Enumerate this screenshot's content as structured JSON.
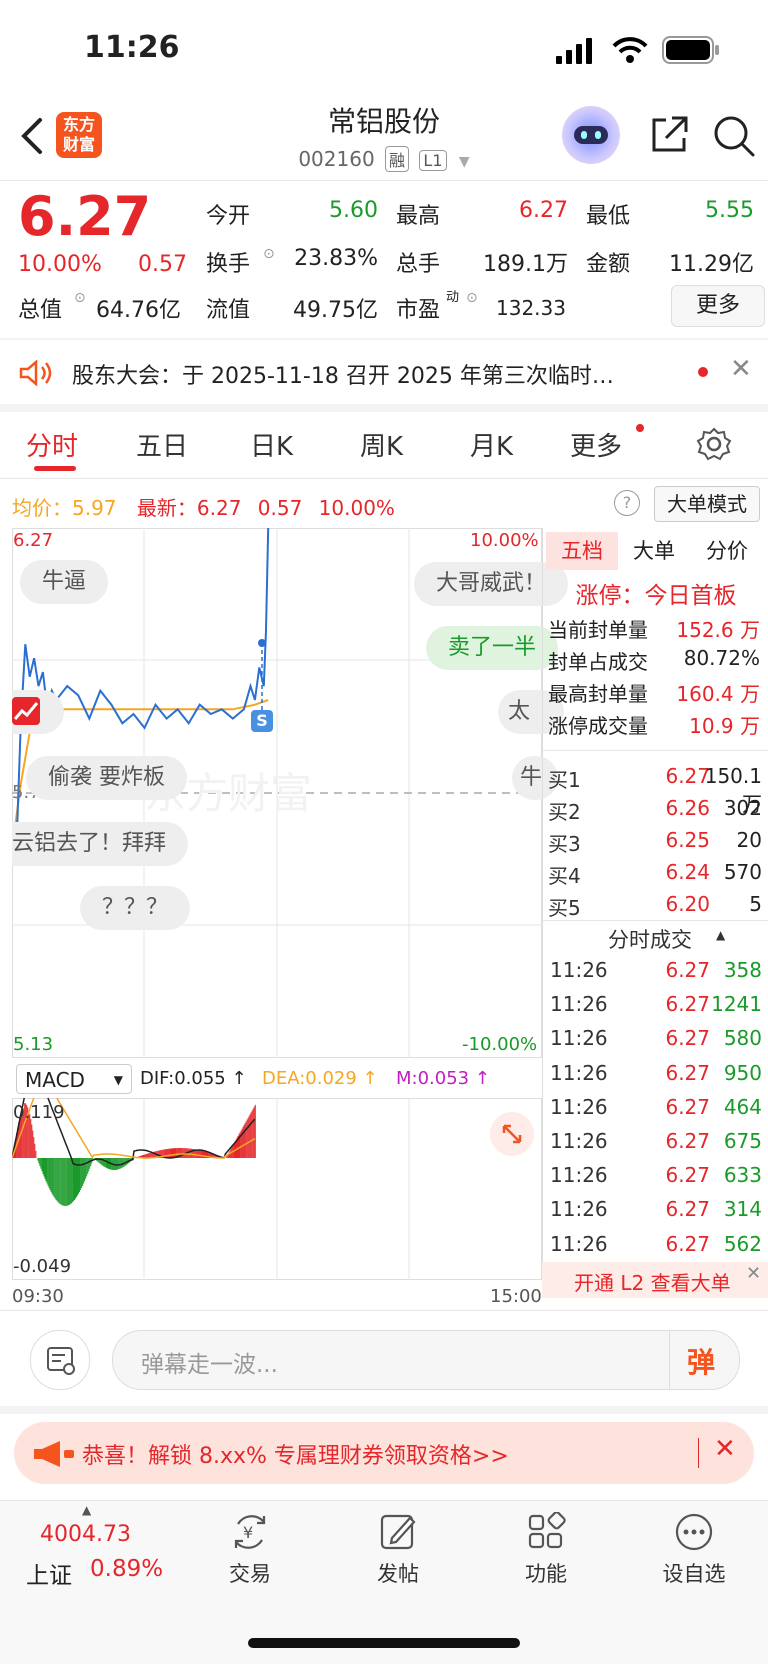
{
  "status_bar": {
    "time": "11:26"
  },
  "header": {
    "title": "常铝股份",
    "code": "002160",
    "tag1": "融",
    "tag2": "L1",
    "logo_text": "东方\n财富"
  },
  "quote": {
    "price": "6.27",
    "change_pct": "10.00%",
    "change_amt": "0.57",
    "open_label": "今开",
    "open": "5.60",
    "high_label": "最高",
    "high": "6.27",
    "low_label": "最低",
    "low": "5.55",
    "turnover_label": "换手",
    "turnover": "23.83%",
    "volume_label": "总手",
    "volume": "189.1万",
    "amount_label": "金额",
    "amount": "11.29亿",
    "mktcap_label": "总值",
    "mktcap": "64.76亿",
    "float_label": "流值",
    "float": "49.75亿",
    "pe_label": "市盈",
    "pe_sup": "动",
    "pe": "132.33",
    "more_label": "更多"
  },
  "notice": {
    "text": "股东大会：于 2025-11-18 召开 2025 年第三次临时…"
  },
  "tabs": [
    "分时",
    "五日",
    "日K",
    "周K",
    "月K",
    "更多"
  ],
  "chart_info": {
    "avg_label": "均价：",
    "avg": "5.97",
    "latest_label": "最新：",
    "latest": "6.27",
    "latest_chg": "0.57",
    "latest_pct": "10.00%",
    "mode_button": "大单模式"
  },
  "chart_labels": {
    "y_top": "6.27",
    "y_mid": "5.70",
    "y_bottom": "5.13",
    "pct_top": "10.00%",
    "pct_bottom": "-10.00%",
    "signal_marker": "S",
    "macd_select": "MACD",
    "dif": "DIF:0.055 ↑",
    "dea": "DEA:0.029 ↑",
    "m": "M:0.053 ↑",
    "macd_top": "0.119",
    "macd_bottom": "-0.049",
    "time_start": "09:30",
    "time_end": "15:00",
    "watermark": "东方财富"
  },
  "danmu": [
    "牛逼",
    "大哥威武！",
    "卖了一半",
    "太",
    "偷袭 要炸板",
    "牛",
    "云铝去了！拜拜",
    "？？？"
  ],
  "right_panel": {
    "tabs": [
      "五档",
      "大单",
      "分价"
    ],
    "limit_status": "涨停：今日首板",
    "stats": [
      {
        "label": "当前封单量",
        "value": "152.6 万"
      },
      {
        "label": "封单占成交",
        "value": "80.72%"
      },
      {
        "label": "最高封单量",
        "value": "160.4 万"
      },
      {
        "label": "涨停成交量",
        "value": "10.9 万"
      }
    ],
    "bids": [
      {
        "label": "买1",
        "price": "6.27",
        "vol": "150.1万"
      },
      {
        "label": "买2",
        "price": "6.26",
        "vol": "302"
      },
      {
        "label": "买3",
        "price": "6.25",
        "vol": "20"
      },
      {
        "label": "买4",
        "price": "6.24",
        "vol": "570"
      },
      {
        "label": "买5",
        "price": "6.20",
        "vol": "5"
      }
    ],
    "trades_header": "分时成交",
    "trades": [
      {
        "time": "11:26",
        "price": "6.27",
        "vol": "358"
      },
      {
        "time": "11:26",
        "price": "6.27",
        "vol": "1241"
      },
      {
        "time": "11:26",
        "price": "6.27",
        "vol": "580"
      },
      {
        "time": "11:26",
        "price": "6.27",
        "vol": "950"
      },
      {
        "time": "11:26",
        "price": "6.27",
        "vol": "464"
      },
      {
        "time": "11:26",
        "price": "6.27",
        "vol": "675"
      },
      {
        "time": "11:26",
        "price": "6.27",
        "vol": "633"
      },
      {
        "time": "11:26",
        "price": "6.27",
        "vol": "314"
      },
      {
        "time": "11:26",
        "price": "6.27",
        "vol": "562"
      }
    ],
    "l2_banner": "开通 L2 查看大单"
  },
  "danmu_input": {
    "placeholder": "弹幕走一波...",
    "send_label": "弹"
  },
  "promo": {
    "text": "恭喜！解锁 8.xx% 专属理财券领取资格>>"
  },
  "bottom_bar": {
    "index_value": "4004.73",
    "index_name": "上证",
    "index_pct": "0.89%",
    "items": [
      "交易",
      "发帖",
      "功能",
      "设自选"
    ]
  },
  "colors": {
    "up": "#e5262a",
    "down": "#1a9a2a",
    "avg_line": "#f5a623",
    "price_line": "#2a6fd1",
    "accent": "#f5541f"
  },
  "chart_data": {
    "type": "line",
    "title": "",
    "x_range": [
      "09:30",
      "15:00"
    ],
    "ylim": [
      5.13,
      6.27
    ],
    "series": [
      {
        "name": "",
        "color": "#2a6fd1",
        "x": [
          "09:30",
          "09:32",
          "09:34",
          "09:36",
          "09:38",
          "09:40",
          "09:42",
          "09:44",
          "09:46",
          "09:48",
          "09:50",
          "09:55",
          "10:00",
          "10:05",
          "10:10",
          "10:15",
          "10:20",
          "10:25",
          "10:30",
          "10:35",
          "10:40",
          "10:45",
          "10:50",
          "10:55",
          "11:00",
          "11:05",
          "11:10",
          "11:15",
          "11:18",
          "11:20",
          "11:22",
          "11:24",
          "11:25",
          "11:26"
        ],
        "values": [
          5.62,
          5.58,
          5.85,
          6.02,
          5.95,
          5.99,
          5.93,
          5.96,
          5.88,
          5.92,
          5.9,
          5.93,
          5.91,
          5.86,
          5.92,
          5.89,
          5.85,
          5.87,
          5.84,
          5.89,
          5.86,
          5.88,
          5.85,
          5.89,
          5.87,
          5.88,
          5.86,
          5.88,
          5.93,
          5.9,
          5.97,
          5.93,
          6.05,
          6.27
        ]
      },
      {
        "name": "",
        "color": "#f5a623",
        "x": [
          "09:30",
          "09:34",
          "09:38",
          "09:42",
          "09:46",
          "09:50",
          "10:00",
          "10:10",
          "10:20",
          "10:30",
          "10:40",
          "10:50",
          "11:00",
          "11:10",
          "11:20",
          "11:26"
        ],
        "values": [
          5.58,
          5.72,
          5.83,
          5.86,
          5.87,
          5.88,
          5.88,
          5.88,
          5.88,
          5.88,
          5.88,
          5.88,
          5.88,
          5.88,
          5.89,
          5.9
        ]
      }
    ]
  }
}
